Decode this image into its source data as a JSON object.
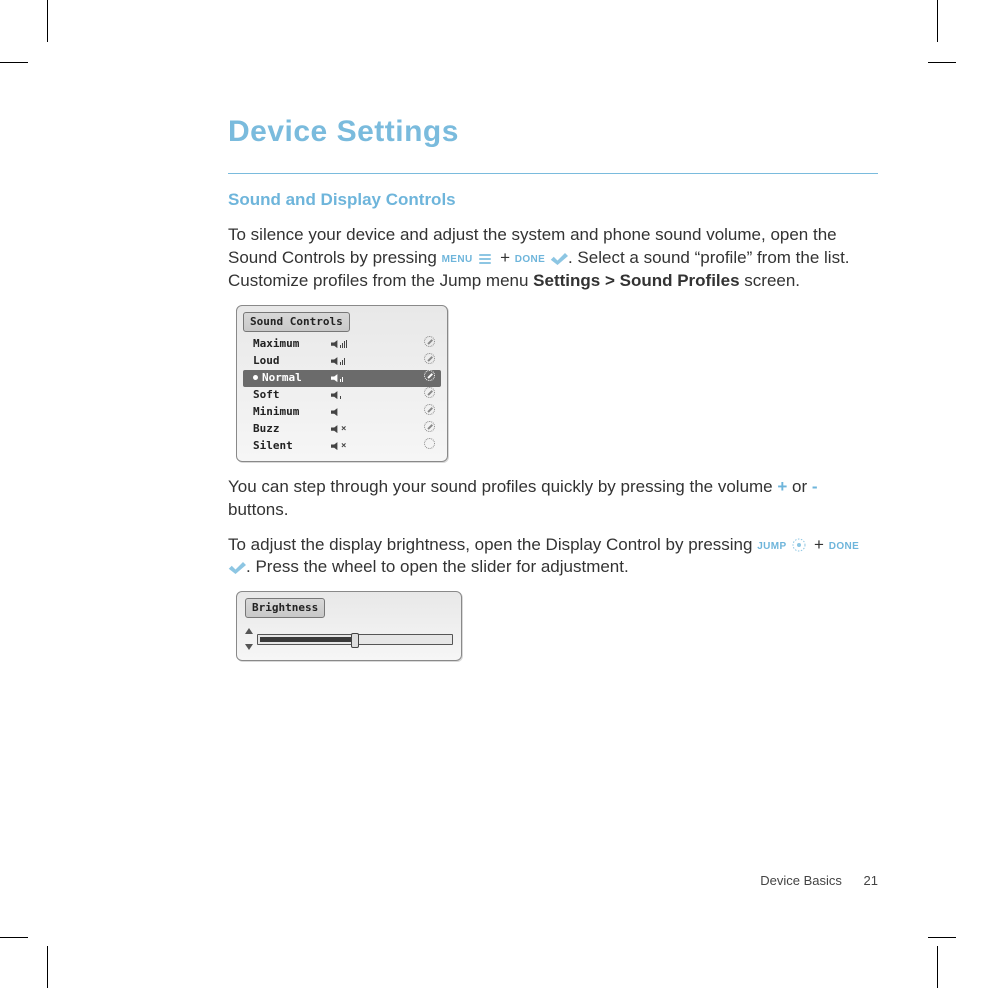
{
  "title": "Device Settings",
  "subhead": "Sound and Display Controls",
  "para1a": "To silence your device and adjust the system and phone sound volume, open the Sound Controls by pressing ",
  "menu_label": "MENU",
  "plus": " + ",
  "done_label": "DONE",
  "para1b": ". Select a sound “profile” from the list. Customize profiles from the Jump menu ",
  "menu_path": "Settings > Sound Profiles",
  "para1c": " screen.",
  "sound_panel": {
    "title": "Sound Controls",
    "rows": [
      {
        "name": "Maximum",
        "level": 4,
        "muted": false,
        "selected": false
      },
      {
        "name": "Loud",
        "level": 3,
        "muted": false,
        "selected": false
      },
      {
        "name": "Normal",
        "level": 2,
        "muted": false,
        "selected": true
      },
      {
        "name": "Soft",
        "level": 1,
        "muted": false,
        "selected": false
      },
      {
        "name": "Minimum",
        "level": 0,
        "muted": false,
        "selected": false
      },
      {
        "name": "Buzz",
        "level": 0,
        "muted": true,
        "selected": false
      },
      {
        "name": "Silent",
        "level": 0,
        "muted": true,
        "selected": false
      }
    ]
  },
  "para2a": "You can step through your sound profiles quickly by pressing the volume ",
  "plus_sym": "+",
  "or": " or ",
  "minus_sym": "-",
  "para2b": " buttons.",
  "para3a": "To adjust the display brightness, open the Display Control by pressing ",
  "jump_label": "JUMP",
  "para3b": ". Press the wheel to open the slider for adjustment.",
  "bright_panel": {
    "title": "Brightness",
    "value_pct": 50
  },
  "footer": {
    "section": "Device Basics",
    "page": "21"
  }
}
